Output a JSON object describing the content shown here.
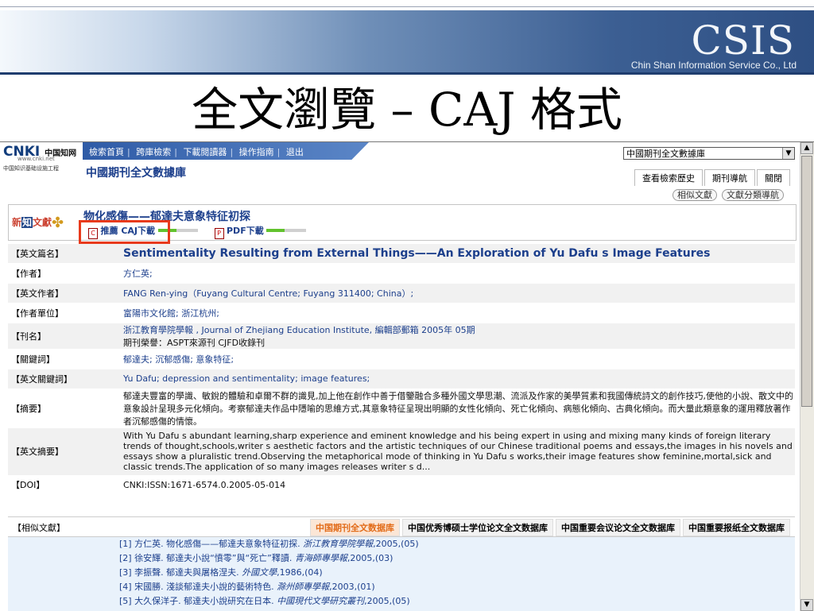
{
  "slide": {
    "title": "全文瀏覽 – CAJ 格式",
    "brand": "CSIS",
    "brand_sub": "Chin Shan Information Service Co., Ltd"
  },
  "cnki": {
    "logo_main": "CNKI",
    "logo_cn": "中国知网",
    "logo_url": "www.cnki.net",
    "logo_tag": "中国知识基础设施工程"
  },
  "topnav": [
    "檢索首頁",
    "跨庫檢索",
    "下載閱讀器",
    "操作指南",
    "退出"
  ],
  "db_select": {
    "value": "中國期刊全文數據庫"
  },
  "db_heading": "中國期刊全文數據庫",
  "right_tabs": [
    "查看檢索歷史",
    "期刊導航",
    "關閉"
  ],
  "sub_links": [
    "相似文獻",
    "文獻分類導航"
  ],
  "article": {
    "title": "物化感傷——郁達夫意象特征初探",
    "pub_logo_left": "新",
    "pub_logo_mid": "知",
    "pub_logo_right": "文獻",
    "pub_logo_wheel": "✤",
    "caj_label": "推薦 CAJ下載",
    "pdf_label": "PDF下載",
    "caj_icon": "C",
    "pdf_icon": "P"
  },
  "meta": [
    {
      "key": "【英文篇名】",
      "val": "Sentimentality Resulting from External Things——An Exploration of Yu Dafu s Image Features"
    },
    {
      "key": "【作者】",
      "val": "方仁英;"
    },
    {
      "key": "【英文作者】",
      "val": "FANG Ren-ying（Fuyang Cultural Centre; Fuyang 311400; China）;"
    },
    {
      "key": "【作者單位】",
      "val": "富陽市文化館; 浙江杭州;"
    },
    {
      "key": "【刊名】",
      "val": "浙江教育學院學報 , Journal of Zhejiang Education Institute, 編輯部郵箱 2005年 05期",
      "val2": "期刊榮譽：ASPT來源刊 CJFD收錄刊"
    },
    {
      "key": "【關鍵詞】",
      "val": "郁達夫; 沉郁感傷; 意象特征;"
    },
    {
      "key": "【英文關鍵詞】",
      "val": "Yu Dafu; depression and sentimentality; image features;"
    },
    {
      "key": "【摘要】",
      "val": "郁達夫豐富的學識、敏銳的體驗和卓爾不群的識見,加上他在創作中善于借鑒融合多種外國文學思潮、流派及作家的美學質素和我國傳統詩文的創作技巧,使他的小說、散文中的意象設計呈現多元化傾向。考察郁達夫作品中隱喻的思維方式,其意象特征呈現出明顯的女性化傾向、死亡化傾向、病態化傾向、古典化傾向。而大量此類意象的運用釋放著作者沉郁感傷的情懷。"
    },
    {
      "key": "【英文摘要】",
      "val": "With Yu Dafu s abundant learning,sharp experience and eminent knowledge and his being expert in using and mixing many kinds of foreign literary trends of thought,schools,writer s aesthetic factors and the artistic techniques of our Chinese traditional poems and essays,the images in his novels and essays show a pluralistic trend.Observing the metaphorical mode of thinking in Yu Dafu s works,their image features show feminine,mortal,sick and classic trends.The application of so many images releases writer s d..."
    },
    {
      "key": "【DOI】",
      "val": "CNKI:ISSN:1671-6574.0.2005-05-014"
    }
  ],
  "related": {
    "key": "【相似文獻】",
    "tabs": [
      "中国期刊全文数据库",
      "中国优秀博硕士学位论文全文数据库",
      "中国重要会议论文全文数据库",
      "中国重要报纸全文数据库"
    ],
    "items": [
      {
        "text": "[1] 方仁英. 物化感傷——郁達夫意象特征初探.",
        "src": "浙江教育學院學報",
        "tail": ",2005,(05)"
      },
      {
        "text": "[2] 徐安輝. 郁達夫小說“憤零”與“死亡”釋讀.",
        "src": "青海師專學報",
        "tail": ",2005,(03)"
      },
      {
        "text": "[3] 李振聲. 郁達夫與屠格涅夫.",
        "src": "外國文學",
        "tail": ",1986,(04)"
      },
      {
        "text": "[4] 宋國勝. 淺談郁達夫小說的藝術特色.",
        "src": "滁州師專學報",
        "tail": ",2003,(01)"
      },
      {
        "text": "[5] 大久保洋子. 郁達夫小說研究在日本.",
        "src": "中國現代文學研究叢刊",
        "tail": ",2005,(05)"
      }
    ]
  },
  "scroll": {
    "up": "▲",
    "down": "▼"
  }
}
